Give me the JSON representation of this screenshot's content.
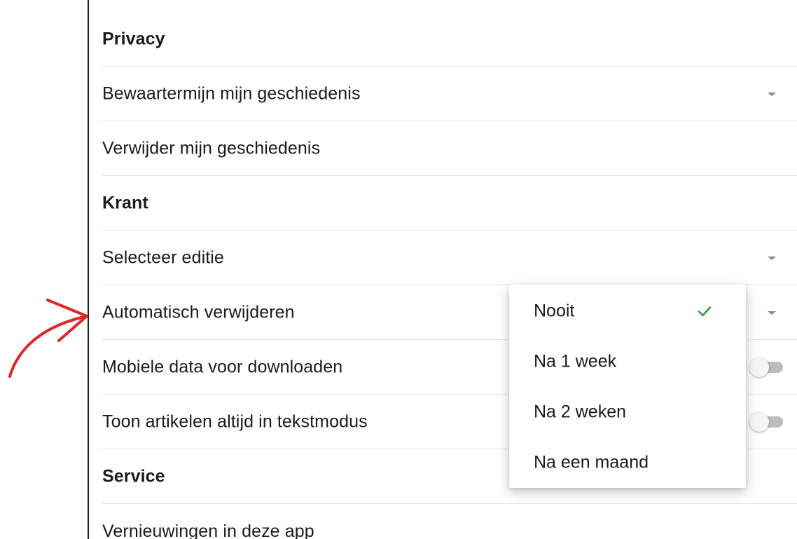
{
  "settings": {
    "privacy_header": "Privacy",
    "retention_label": "Bewaartermijn mijn geschiedenis",
    "delete_history_label": "Verwijder mijn geschiedenis",
    "krant_header": "Krant",
    "select_edition_label": "Selecteer editie",
    "auto_delete_label": "Automatisch verwijderen",
    "mobile_data_label": "Mobiele data voor downloaden",
    "text_mode_label": "Toon artikelen altijd in tekstmodus",
    "service_header": "Service",
    "updates_label": "Vernieuwingen in deze app"
  },
  "toggles": {
    "mobile_data_on": false,
    "text_mode_on": false
  },
  "dropdown": {
    "options": [
      "Nooit",
      "Na 1 week",
      "Na 2 weken",
      "Na een maand"
    ],
    "selected": "Nooit"
  },
  "colors": {
    "check": "#3a9a3f",
    "annotation_arrow": "#e0262a",
    "toggle_track": "#bdbdbd"
  },
  "icons": {
    "caret": "caret-down-icon",
    "check": "check-icon",
    "arrow": "annotation-arrow"
  }
}
